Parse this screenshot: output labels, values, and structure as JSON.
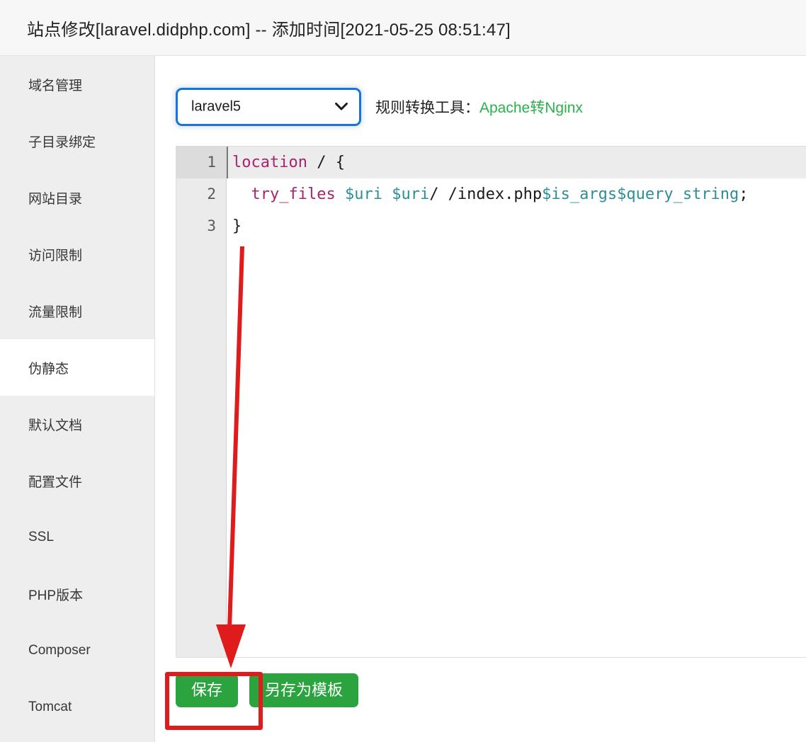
{
  "header": {
    "title": "站点修改[laravel.didphp.com] -- 添加时间[2021-05-25 08:51:47]"
  },
  "sidebar": {
    "items": [
      {
        "label": "域名管理",
        "name": "sidebar-item-domain-management",
        "active": false
      },
      {
        "label": "子目录绑定",
        "name": "sidebar-item-subdirectory-binding",
        "active": false
      },
      {
        "label": "网站目录",
        "name": "sidebar-item-site-directory",
        "active": false
      },
      {
        "label": "访问限制",
        "name": "sidebar-item-access-restriction",
        "active": false
      },
      {
        "label": "流量限制",
        "name": "sidebar-item-traffic-limit",
        "active": false
      },
      {
        "label": "伪静态",
        "name": "sidebar-item-rewrite",
        "active": true
      },
      {
        "label": "默认文档",
        "name": "sidebar-item-default-document",
        "active": false
      },
      {
        "label": "配置文件",
        "name": "sidebar-item-config-file",
        "active": false
      },
      {
        "label": "SSL",
        "name": "sidebar-item-ssl",
        "active": false
      },
      {
        "label": "PHP版本",
        "name": "sidebar-item-php-version",
        "active": false
      },
      {
        "label": "Composer",
        "name": "sidebar-item-composer",
        "active": false
      },
      {
        "label": "Tomcat",
        "name": "sidebar-item-tomcat",
        "active": false
      }
    ]
  },
  "toolbar": {
    "template_select": {
      "value": "laravel5",
      "caret_icon": "chevron-down-icon"
    },
    "converter_label": "规则转换工具：",
    "converter_link": "Apache转Nginx",
    "link_color": "#2bb24c"
  },
  "editor": {
    "line_numbers": [
      "1",
      "2",
      "3"
    ],
    "active_line": 1,
    "lines": [
      {
        "number": "1",
        "text": "location / {",
        "tokens": [
          {
            "t": "location",
            "c": "kw"
          },
          {
            "t": " / {",
            "c": "pun"
          }
        ]
      },
      {
        "number": "2",
        "text": "  try_files $uri $uri/ /index.php$is_args$query_string;",
        "tokens": [
          {
            "t": "  ",
            "c": "pun"
          },
          {
            "t": "try_files",
            "c": "kw"
          },
          {
            "t": " ",
            "c": "pun"
          },
          {
            "t": "$uri",
            "c": "var"
          },
          {
            "t": " ",
            "c": "pun"
          },
          {
            "t": "$uri",
            "c": "var"
          },
          {
            "t": "/ /index.php",
            "c": "pun"
          },
          {
            "t": "$is_args$query_string",
            "c": "var"
          },
          {
            "t": ";",
            "c": "pun"
          }
        ]
      },
      {
        "number": "3",
        "text": "}",
        "tokens": [
          {
            "t": "}",
            "c": "pun"
          }
        ]
      }
    ]
  },
  "buttons": {
    "save": "保存",
    "save_as_template": "另存为模板",
    "color": "#2ba33f"
  },
  "annotations": {
    "arrow_color": "#e01b1b",
    "box_color": "#e01b1b"
  }
}
